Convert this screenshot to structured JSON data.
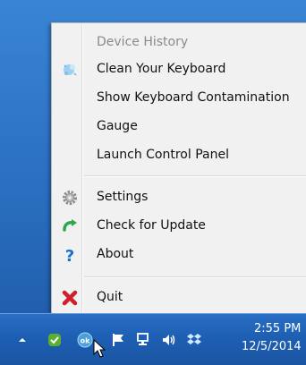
{
  "menu": {
    "items": [
      {
        "label": "Device History",
        "disabled": true,
        "icon": null
      },
      {
        "label": "Clean Your Keyboard",
        "icon": "cleaning-sparkle-icon"
      },
      {
        "label": "Show Keyboard Contamination",
        "icon": null
      },
      {
        "label": "Gauge",
        "icon": null
      },
      {
        "label": "Launch Control Panel",
        "icon": null
      },
      {
        "label": "Settings",
        "icon": "gear-icon"
      },
      {
        "label": "Check for Update",
        "icon": "refresh-arrow-icon"
      },
      {
        "label": "About",
        "icon": "question-mark-icon"
      },
      {
        "label": "Quit",
        "icon": "red-x-icon"
      }
    ]
  },
  "taskbar": {
    "icons": [
      "chevron-up-icon",
      "shield-app-icon",
      "ok-app-icon",
      "action-center-flag-icon",
      "network-icon",
      "volume-icon",
      "dropbox-icon"
    ],
    "clock_time": "2:55 PM",
    "clock_date": "12/5/2014"
  },
  "colors": {
    "menu_bg": "#f1f1f1",
    "taskbar": "#1e5fb3",
    "quit_red": "#d2202a",
    "update_green": "#2aa84a",
    "about_blue": "#1a6fd0"
  }
}
